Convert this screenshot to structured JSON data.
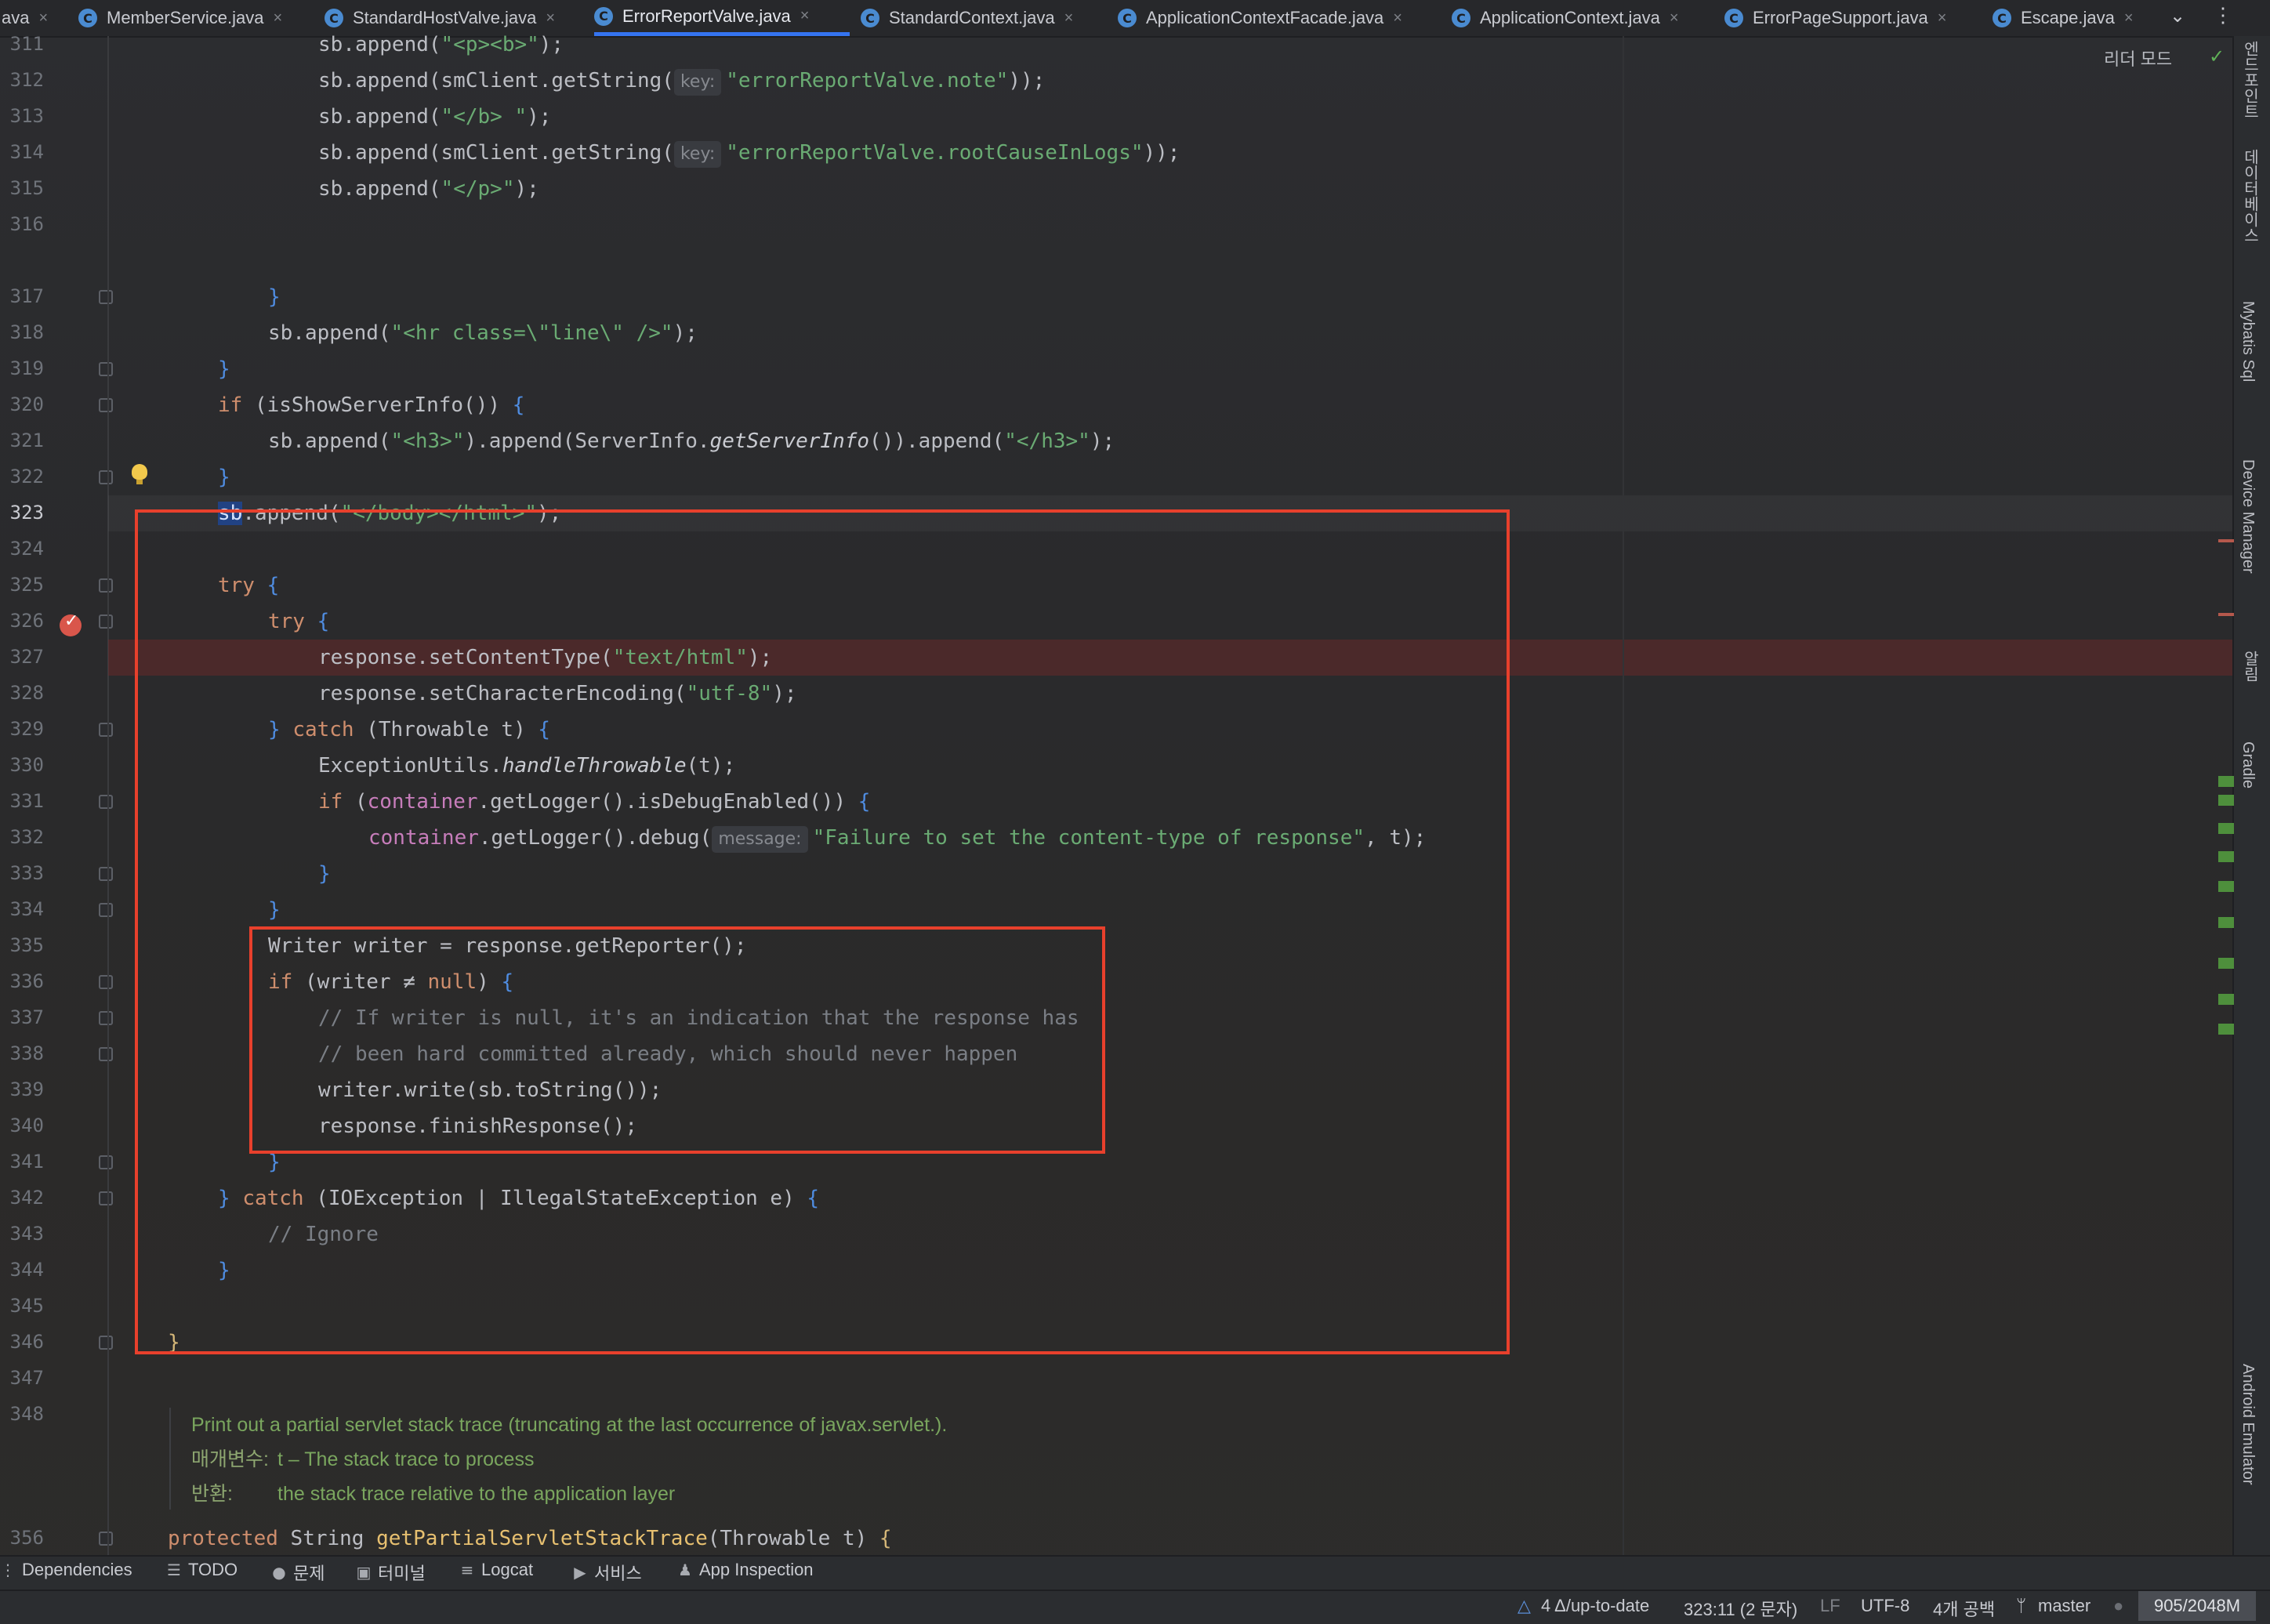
{
  "tabs": [
    {
      "label": "ava",
      "closable": true,
      "active": false,
      "icon": "none"
    },
    {
      "label": "MemberService.java",
      "closable": true,
      "active": false,
      "icon": "class-icon"
    },
    {
      "label": "StandardHostValve.java",
      "closable": true,
      "active": false,
      "icon": "class-icon"
    },
    {
      "label": "ErrorReportValve.java",
      "closable": true,
      "active": true,
      "icon": "class-icon"
    },
    {
      "label": "StandardContext.java",
      "closable": true,
      "active": false,
      "icon": "class-icon"
    },
    {
      "label": "ApplicationContextFacade.java",
      "closable": true,
      "active": false,
      "icon": "class-icon"
    },
    {
      "label": "ApplicationContext.java",
      "closable": true,
      "active": false,
      "icon": "class-icon"
    },
    {
      "label": "ErrorPageSupport.java",
      "closable": true,
      "active": false,
      "icon": "class-icon"
    },
    {
      "label": "Escape.java",
      "closable": true,
      "active": false,
      "icon": "class-icon"
    }
  ],
  "tab_dropdown": "⌄",
  "tab_more": "⋮",
  "reader_mode": "리더 모드",
  "line_numbers": [
    "311",
    "312",
    "313",
    "314",
    "315",
    "316",
    "317",
    "318",
    "319",
    "320",
    "321",
    "322",
    "323",
    "324",
    "325",
    "326",
    "327",
    "328",
    "329",
    "330",
    "331",
    "332",
    "333",
    "334",
    "335",
    "336",
    "337",
    "338",
    "339",
    "340",
    "341",
    "342",
    "343",
    "344",
    "345",
    "346",
    "347",
    "348",
    "356"
  ],
  "current_line": "323",
  "breakpoint_line": "327",
  "code": {
    "l311": {
      "pre": "sb.append(",
      "s": "\"<p><b>\"",
      "post": ");"
    },
    "l312": {
      "pre": "sb.append(smClient.getString(",
      "hint": "key:",
      "s": "\"errorReportValve.note\"",
      "post": "));"
    },
    "l313": {
      "pre": "sb.append(",
      "s": "\"</b> \"",
      "post": ");"
    },
    "l314": {
      "pre": "sb.append(smClient.getString(",
      "hint": "key:",
      "s": "\"errorReportValve.rootCauseInLogs\"",
      "post": "));"
    },
    "l315": {
      "pre": "sb.append(",
      "s": "\"</p>\"",
      "post": ");"
    },
    "l317": {
      "brace": "}"
    },
    "l318": {
      "pre": "sb.append(",
      "s": "\"<hr class=\\\"line\\\" />\"",
      "post": ");"
    },
    "l319": {
      "brace": "}"
    },
    "l320": {
      "kw": "if",
      "pre": " (isShowServerInfo()) ",
      "brace": "{"
    },
    "l321": {
      "pre": "sb.append(",
      "s": "\"<h3>\"",
      "mid": ").append(ServerInfo.",
      "ital": "getServerInfo",
      "mid2": "()).append(",
      "s2": "\"</h3>\"",
      "post": ");"
    },
    "l322": {
      "brace": "}"
    },
    "l323": {
      "sel": "sb",
      "pre": ".append(",
      "s": "\"</body></html>\"",
      "post": ");"
    },
    "l325": {
      "kw": "try",
      "brace": "{"
    },
    "l326": {
      "kw": "try",
      "brace": "{"
    },
    "l327": {
      "pre": "response.setContentType(",
      "s": "\"text/html\"",
      "post": ");"
    },
    "l328": {
      "pre": "response.setCharacterEncoding(",
      "s": "\"utf-8\"",
      "post": ");"
    },
    "l329": {
      "brace": "}",
      "kw": "catch",
      "pre": " (Throwable t) ",
      "brace2": "{"
    },
    "l330": {
      "pre": "ExceptionUtils.",
      "ital": "handleThrowable",
      "post": "(t);"
    },
    "l331": {
      "kw": "if",
      "pre": " (",
      "fld": "container",
      "post": ".getLogger().isDebugEnabled()) ",
      "brace": "{"
    },
    "l332": {
      "fld": "container",
      "pre": ".getLogger().debug(",
      "hint": "message:",
      "s": "\"Failure to set the content-type of response\"",
      "post": ", t);"
    },
    "l333": {
      "brace": "}"
    },
    "l334": {
      "brace": "}"
    },
    "l335": {
      "pre": "Writer writer = response.getReporter();"
    },
    "l336": {
      "kw": "if",
      "pre": " (writer ≠ ",
      "kw2": "null",
      "post": ") ",
      "brace": "{"
    },
    "l337": {
      "comment": "// If writer is null, it's an indication that the response has"
    },
    "l338": {
      "comment": "// been hard committed already, which should never happen"
    },
    "l339": {
      "pre": "writer.write(sb.toString());"
    },
    "l340": {
      "pre": "response.finishResponse();"
    },
    "l341": {
      "brace": "}"
    },
    "l342": {
      "brace": "}",
      "kw": "catch",
      "pre": " (IOException | IllegalStateException e) ",
      "brace2": "{"
    },
    "l343": {
      "comment": "// Ignore"
    },
    "l344": {
      "brace": "}"
    },
    "l346": {
      "brace": "}"
    },
    "l356": {
      "kw": "protected",
      "pre": " String ",
      "fn": "getPartialServletStackTrace",
      "post": "(Throwable t) ",
      "brace": "{"
    }
  },
  "javadoc": {
    "summary": "Print out a partial servlet stack trace (truncating at the last occurrence of javax.servlet.).",
    "param_label": "매개변수:",
    "param_text": "t – The stack trace to process",
    "return_label": "반환:",
    "return_text": "the stack trace relative to the application layer"
  },
  "right_tools": [
    "엔드포인트",
    "데이터베이스",
    "Mybatis Sql",
    "Device Manager",
    "알림",
    "Gradle",
    "Android Emulator"
  ],
  "tool_windows": [
    {
      "label": "Dependencies",
      "icon": "dependencies-icon"
    },
    {
      "label": "TODO",
      "icon": "todo-list-icon"
    },
    {
      "label": "문제",
      "icon": "problems-icon"
    },
    {
      "label": "터미널",
      "icon": "terminal-icon"
    },
    {
      "label": "Logcat",
      "icon": "logcat-icon"
    },
    {
      "label": "서비스",
      "icon": "services-icon"
    },
    {
      "label": "App Inspection",
      "icon": "app-inspection-icon"
    }
  ],
  "status": {
    "vcs": "4 Δ/up-to-date",
    "position": "323:11 (2 문자)",
    "line_sep": "LF",
    "encoding": "UTF-8",
    "indent": "4개 공백",
    "branch": "master",
    "memory": "905/2048M"
  },
  "colors": {
    "accent": "#3574f0",
    "highlight_box": "#e8402c",
    "breakpoint": "#d9564b"
  }
}
